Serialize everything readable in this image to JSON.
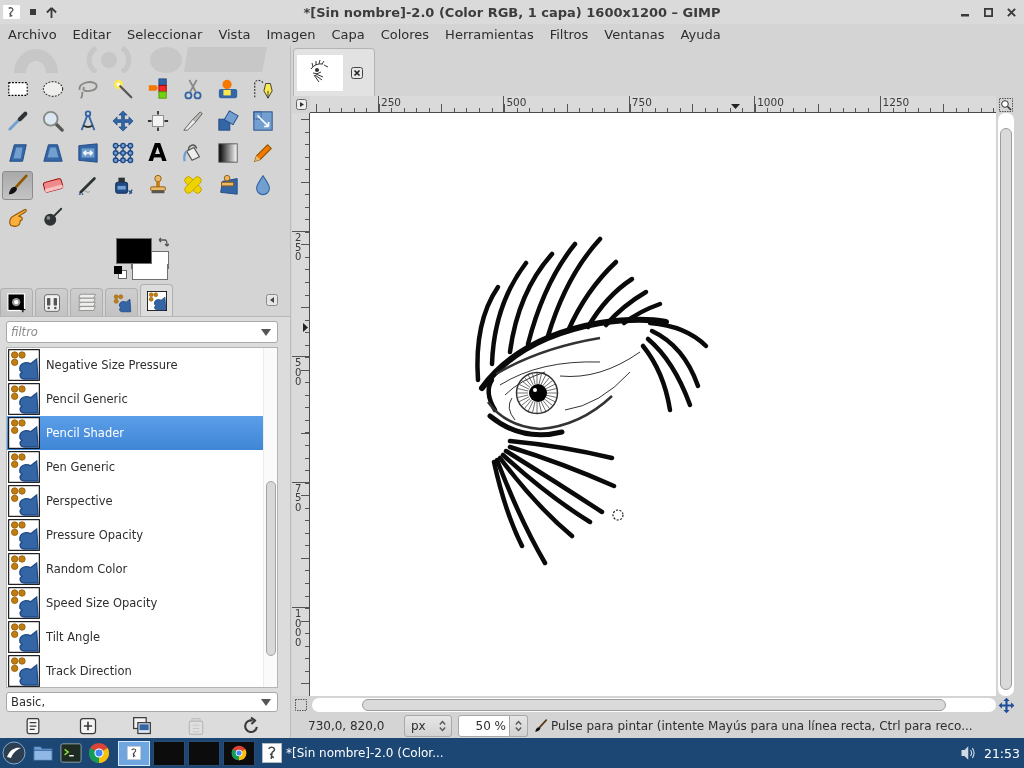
{
  "window": {
    "title": "*[Sin nombre]-2.0 (Color RGB, 1 capa) 1600x1200 – GIMP"
  },
  "menu": [
    "Archivo",
    "Editar",
    "Seleccionar",
    "Vista",
    "Imagen",
    "Capa",
    "Colores",
    "Herramientas",
    "Filtros",
    "Ventanas",
    "Ayuda"
  ],
  "toolbox": {
    "tools": [
      {
        "kind": "rectangle",
        "selected": false
      },
      {
        "kind": "ellipse",
        "selected": false
      },
      {
        "kind": "lasso",
        "selected": false
      },
      {
        "kind": "wand",
        "selected": false
      },
      {
        "kind": "bycolor",
        "selected": false
      },
      {
        "kind": "scissors",
        "selected": false
      },
      {
        "kind": "foreground",
        "selected": false
      },
      {
        "kind": "paths",
        "selected": false
      },
      {
        "kind": "picker",
        "selected": false
      },
      {
        "kind": "zoom",
        "selected": false
      },
      {
        "kind": "measure",
        "selected": false
      },
      {
        "kind": "move",
        "selected": false
      },
      {
        "kind": "align",
        "selected": false
      },
      {
        "kind": "crop",
        "selected": false
      },
      {
        "kind": "rotate",
        "selected": false
      },
      {
        "kind": "scale",
        "selected": false
      },
      {
        "kind": "shear",
        "selected": false
      },
      {
        "kind": "perspective",
        "selected": false
      },
      {
        "kind": "flip",
        "selected": false
      },
      {
        "kind": "cage",
        "selected": false
      },
      {
        "kind": "text",
        "label": "A",
        "selected": false
      },
      {
        "kind": "bucket",
        "selected": false
      },
      {
        "kind": "blend",
        "selected": false
      },
      {
        "kind": "pencil",
        "selected": false
      },
      {
        "kind": "brush",
        "selected": true
      },
      {
        "kind": "eraser",
        "selected": false
      },
      {
        "kind": "airbrush",
        "selected": false
      },
      {
        "kind": "ink",
        "selected": false
      },
      {
        "kind": "clone",
        "selected": false
      },
      {
        "kind": "heal",
        "selected": false
      },
      {
        "kind": "perspclone",
        "selected": false
      },
      {
        "kind": "blur",
        "selected": false
      },
      {
        "kind": "smudge",
        "selected": false
      },
      {
        "kind": "dodge",
        "selected": false
      }
    ],
    "colors": {
      "foreground": {
        "color": "#000000"
      },
      "background": {
        "color": "#ffffff"
      }
    }
  },
  "dock": {
    "tabs": [
      {
        "kind": "options",
        "selected": false
      },
      {
        "kind": "devices",
        "selected": false
      },
      {
        "kind": "layers",
        "selected": false
      },
      {
        "kind": "dynamics",
        "selected": false
      },
      {
        "kind": "editor",
        "selected": true
      }
    ],
    "filter": {
      "placeholder": "filtro"
    },
    "items": [
      {
        "name": "Negative Size Pressure",
        "selected": false
      },
      {
        "name": "Pencil Generic",
        "selected": false
      },
      {
        "name": "Pencil Shader",
        "selected": true
      },
      {
        "name": "Pen Generic",
        "selected": false
      },
      {
        "name": "Perspective",
        "selected": false
      },
      {
        "name": "Pressure Opacity",
        "selected": false
      },
      {
        "name": "Random Color",
        "selected": false
      },
      {
        "name": "Speed Size Opacity",
        "selected": false
      },
      {
        "name": "Tilt Angle",
        "selected": false
      },
      {
        "name": "Track Direction",
        "selected": false
      }
    ],
    "tag_field": {
      "value": "Basic,"
    },
    "actions": [
      {
        "kind": "edit",
        "disabled": false
      },
      {
        "kind": "new",
        "disabled": false
      },
      {
        "kind": "duplicate",
        "disabled": false
      },
      {
        "kind": "delete",
        "disabled": true
      },
      {
        "kind": "refresh",
        "disabled": false
      }
    ]
  },
  "image_window": {
    "tabs": [
      {
        "selected": true
      }
    ],
    "h_ruler": [
      "250",
      "500",
      "750",
      "1000",
      "1250"
    ],
    "v_ruler": [
      "250",
      "500",
      "750",
      "1000"
    ]
  },
  "status_bar": {
    "coordinates": "730,0, 820,0",
    "unit": "px",
    "zoom": "50 %",
    "message": "Pulse para pintar (intente Mayús para una línea recta, Ctrl para reco..."
  },
  "taskbar": {
    "desktops": [
      {
        "kind": "window",
        "selected": true
      },
      {
        "kind": "empty",
        "selected": false
      },
      {
        "kind": "empty",
        "selected": false
      },
      {
        "kind": "browser",
        "selected": false
      }
    ],
    "tasks": [
      {
        "title": "*[Sin nombre]-2.0 (Color...",
        "selected": false
      }
    ],
    "clock": "21:53"
  }
}
